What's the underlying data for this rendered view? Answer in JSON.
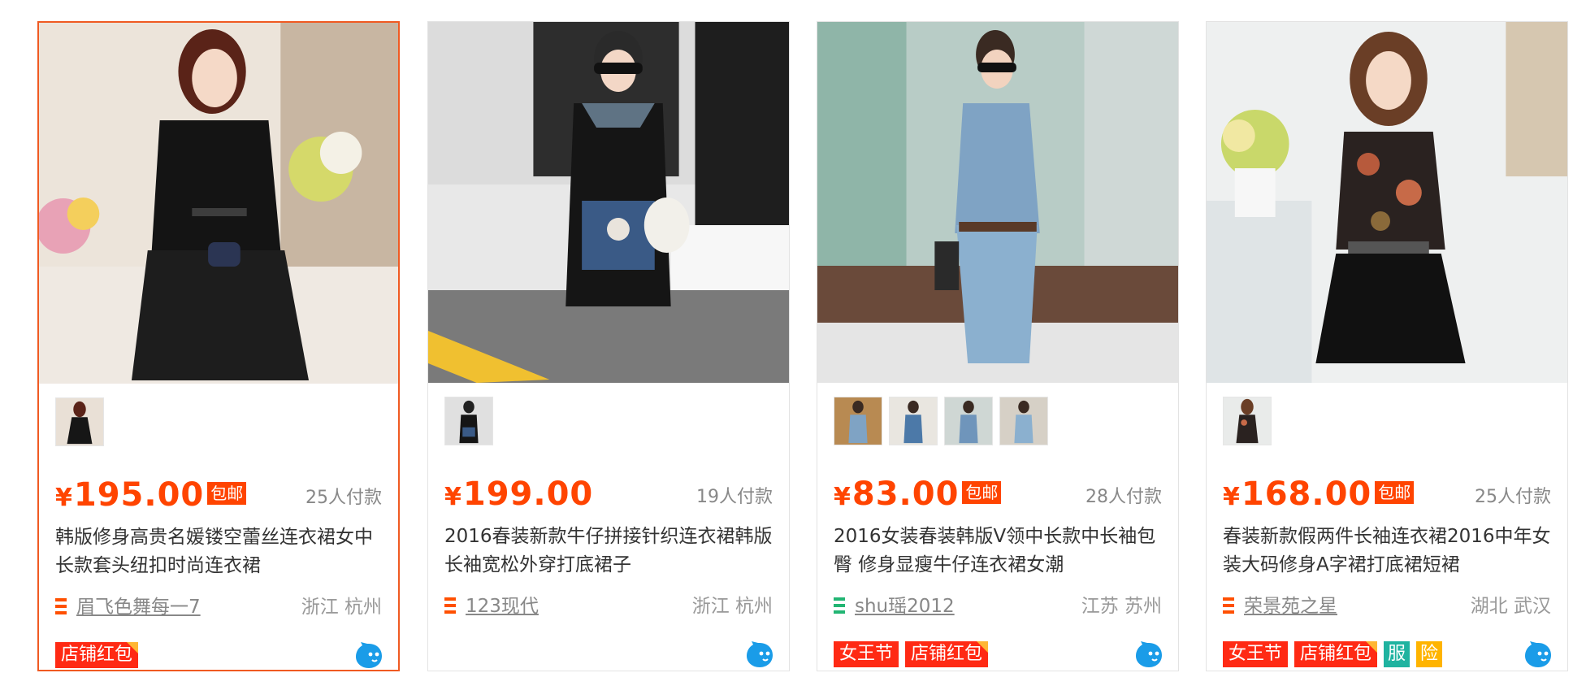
{
  "products": [
    {
      "price_currency": "¥",
      "price": "195.00",
      "free_shipping": "包邮",
      "sales": "25人付款",
      "title": "韩版修身高贵名媛镂空蕾丝连衣裙女中长款套头纽扣时尚连衣裙",
      "shop": "眉飞色舞每一7",
      "location": "浙江 杭州",
      "tags": [
        "店铺红包"
      ],
      "extra_badges": [],
      "thumbnail_count": 1,
      "selected": true,
      "shop_icon_color": "#ff5000"
    },
    {
      "price_currency": "¥",
      "price": "199.00",
      "free_shipping": "",
      "sales": "19人付款",
      "title": "2016春装新款牛仔拼接针织连衣裙韩版长袖宽松外穿打底裙子",
      "shop": "123现代",
      "location": "浙江 杭州",
      "tags": [],
      "extra_badges": [],
      "thumbnail_count": 1,
      "selected": false,
      "shop_icon_color": "#ff5000"
    },
    {
      "price_currency": "¥",
      "price": "83.00",
      "free_shipping": "包邮",
      "sales": "28人付款",
      "title": "2016女装春装韩版V领中长款中长袖包臀 修身显瘦牛仔连衣裙女潮",
      "shop": "shu瑶2012",
      "location": "江苏 苏州",
      "tags": [
        "女王节",
        "店铺红包"
      ],
      "extra_badges": [],
      "thumbnail_count": 4,
      "selected": false,
      "shop_icon_color": "#22b573"
    },
    {
      "price_currency": "¥",
      "price": "168.00",
      "free_shipping": "包邮",
      "sales": "25人付款",
      "title": "春装新款假两件长袖连衣裙2016中年女装大码修身A字裙打底裙短裙",
      "shop": "荣景苑之星",
      "location": "湖北 武汉",
      "tags": [
        "女王节",
        "店铺红包"
      ],
      "extra_badges": [
        {
          "label": "服",
          "color": "#1fb3a0"
        },
        {
          "label": "险",
          "color": "#ffb400"
        }
      ],
      "thumbnail_count": 1,
      "selected": false,
      "shop_icon_color": "#ff5000"
    }
  ],
  "colors": {
    "accent": "#ff4400",
    "tag_red": "#ff2a14",
    "wangwang_blue": "#1a9ce8"
  },
  "icons": {
    "shop": "shop-level-icon",
    "chat": "wangwang-chat-icon"
  }
}
